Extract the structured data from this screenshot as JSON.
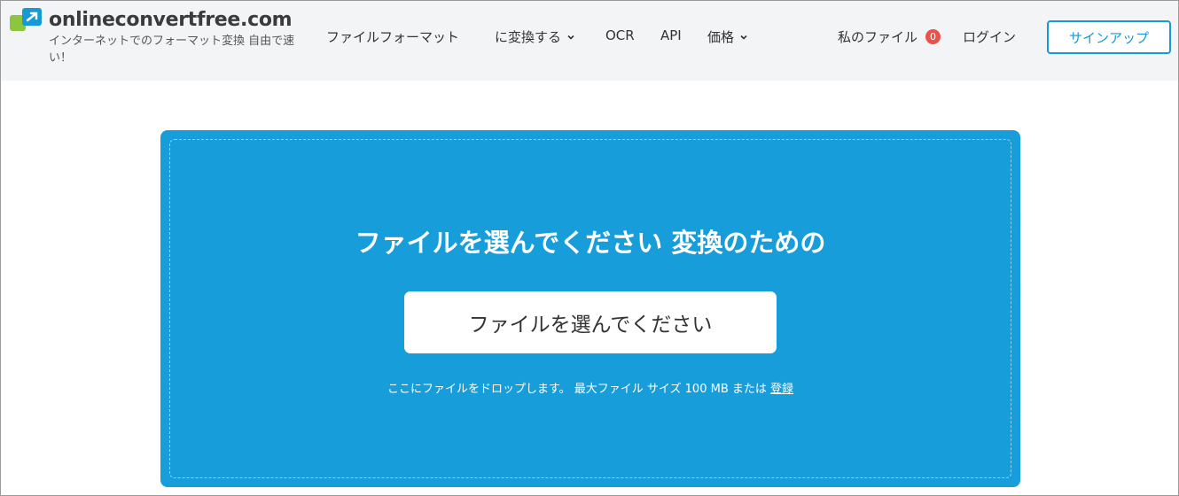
{
  "header": {
    "logo_text": "onlineconvertfree.com",
    "tagline": "インターネットでのフォーマット変換 自由で速い！",
    "nav": [
      {
        "label": "ファイルフォーマット",
        "has_dropdown": false
      },
      {
        "label": "に変換する",
        "has_dropdown": true
      },
      {
        "label": "OCR",
        "has_dropdown": false
      },
      {
        "label": "API",
        "has_dropdown": false
      },
      {
        "label": "価格",
        "has_dropdown": true
      }
    ],
    "my_files_label": "私のファイル",
    "my_files_count": "0",
    "login_label": "ログイン",
    "signup_label": "サインアップ"
  },
  "upload": {
    "title": "ファイルを選んでください 変換のための",
    "button_label": "ファイルを選んでください",
    "hint_text": "ここにファイルをドロップします。 最大ファイル サイズ 100 MB または ",
    "hint_link": "登録"
  },
  "colors": {
    "accent": "#1799d6",
    "panel": "#179dd9",
    "badge": "#e8524b",
    "header_bg": "#f3f4f6"
  }
}
